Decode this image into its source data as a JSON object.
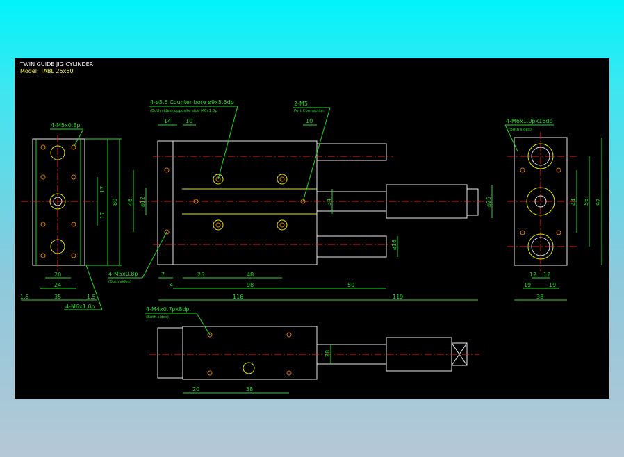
{
  "title": "TWIN GUIDE JIG CYLINDER",
  "model": "Model: TABL 25x50",
  "colors": {
    "canvas": "#000000",
    "dimension": "#22dd22",
    "outline": "#e8e8e8",
    "centerline": "#e02020",
    "hidden": "#e6e600"
  },
  "notes": {
    "counterbore": "4-ø5.5 Counter bore ø9x5.5dp",
    "counterbore_sub": "(Both sides),opposite side M6x1.0p",
    "port": "2-M5",
    "port_sub": "Port Connection",
    "m5_top": "4-M5x0.8p",
    "m6_right": "4-M6x1.0px15dp",
    "m6_right_sub": "(Both sides)",
    "m5_side": "4-M5x0.8p",
    "m5_side_sub": "(Both sides)",
    "m6_left": "4-M6x1.0p",
    "m4": "4-M4x0.7px8dp.",
    "m4_sub": "(Both sides)"
  },
  "dims": {
    "left": [
      "17",
      "80",
      "17",
      "20",
      "24",
      "35",
      "1.5",
      "1.5"
    ],
    "front": [
      "14",
      "10",
      "10",
      "46",
      "ø12",
      "34",
      "ø25",
      "ø16",
      "7",
      "25",
      "48",
      "4",
      "98",
      "50",
      "116",
      "119"
    ],
    "right": [
      "44",
      "56",
      "92",
      "12",
      "12",
      "19",
      "19",
      "38"
    ],
    "bottom": [
      "28",
      "20",
      "58"
    ]
  }
}
